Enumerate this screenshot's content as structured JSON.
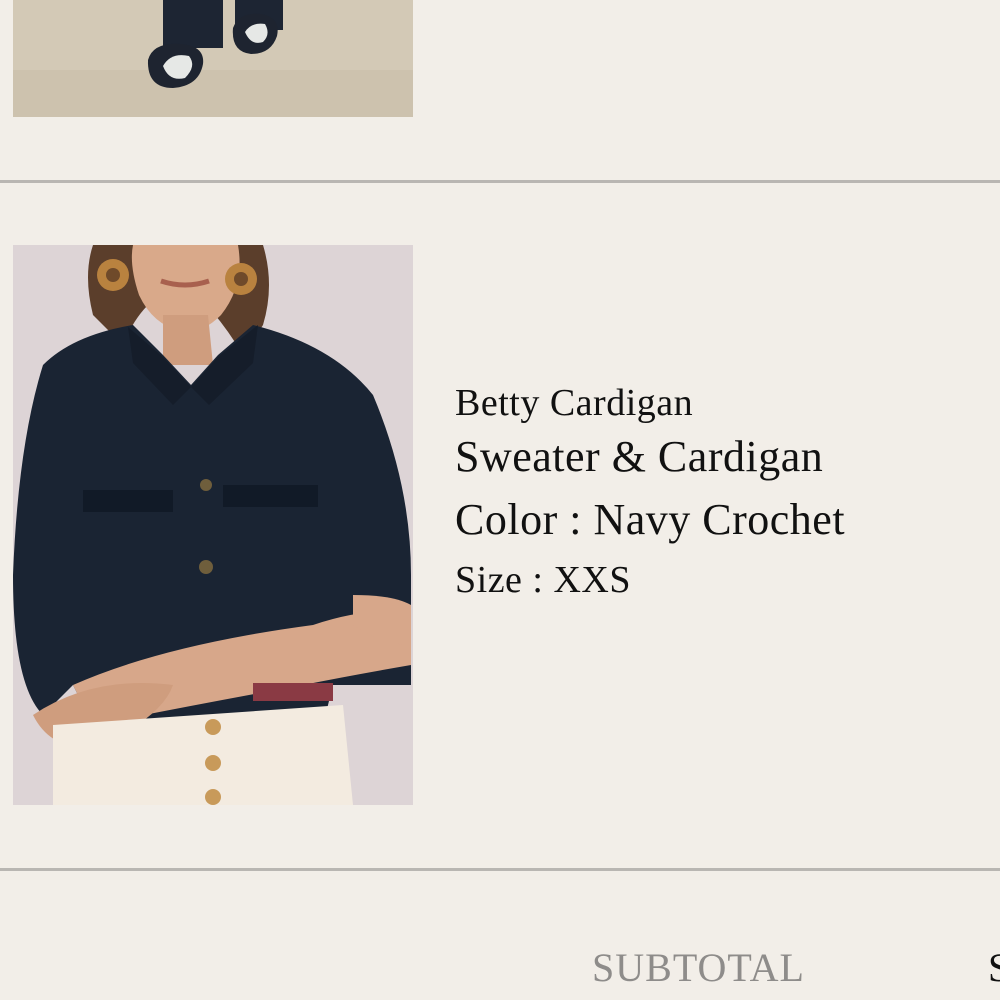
{
  "cart": {
    "items": [
      {
        "image_alt": "Model wearing navy trousers and loafers"
      },
      {
        "name": "Betty Cardigan",
        "category": "Sweater & Cardigan",
        "color_label": "Color : Navy Crochet",
        "size_label": "Size : XXS",
        "image_alt": "Model wearing navy cropped cardigan with arms crossed"
      }
    ],
    "subtotal": {
      "label": "SUBTOTAL",
      "value": "S"
    }
  }
}
